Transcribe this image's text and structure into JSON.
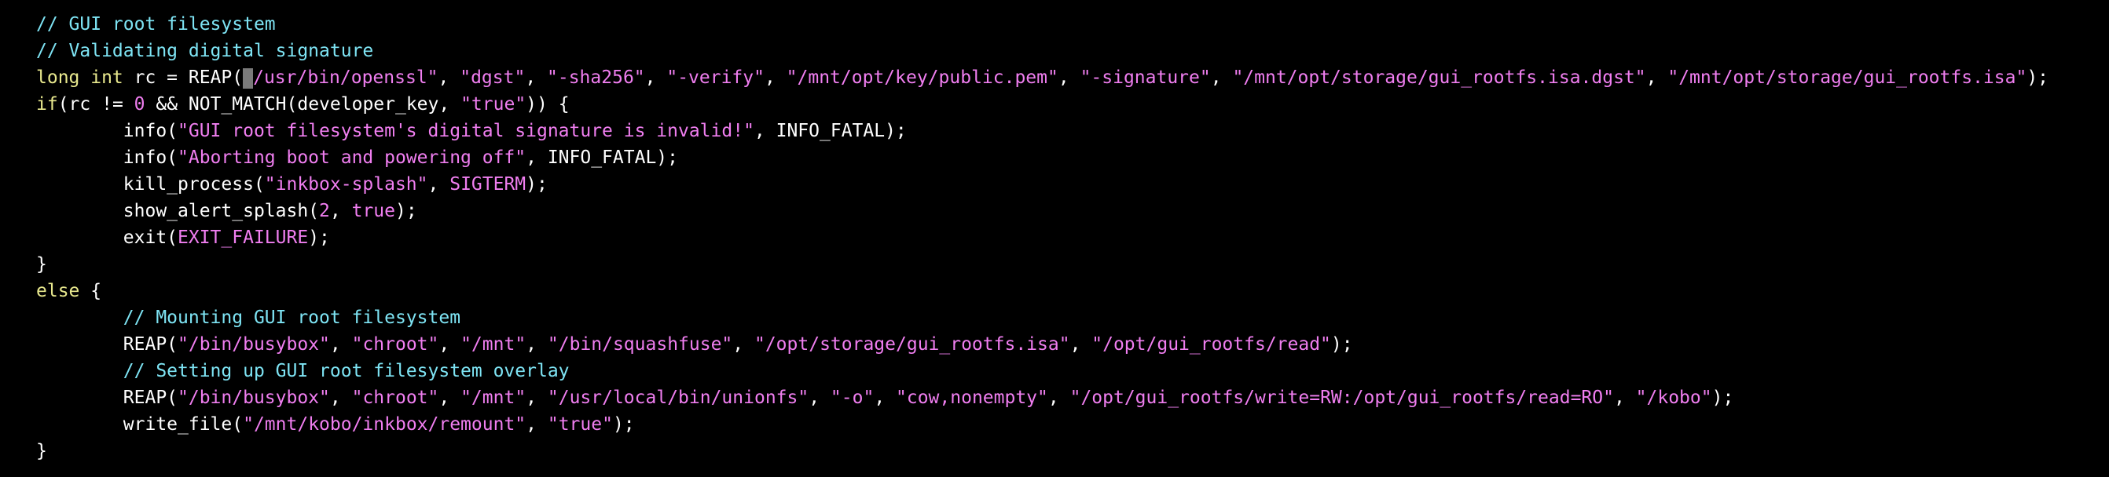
{
  "theme": {
    "background": "#000000",
    "text": "#ffffff",
    "comment": "#7ee4f4",
    "keyword": "#e9e98e",
    "string": "#f07ef0",
    "cursor": "#7a7a7a"
  },
  "code": {
    "lines": [
      [
        {
          "t": "// GUI root filesystem",
          "c": "comment"
        }
      ],
      [
        {
          "t": "// Validating digital signature",
          "c": "comment"
        }
      ],
      [
        {
          "t": "long int",
          "c": "type"
        },
        {
          "t": " rc = REAP(",
          "c": "plain"
        },
        {
          "t": "\"",
          "c": "cursor"
        },
        {
          "t": "/usr/bin/openssl\"",
          "c": "str"
        },
        {
          "t": ", ",
          "c": "plain"
        },
        {
          "t": "\"dgst\"",
          "c": "str"
        },
        {
          "t": ", ",
          "c": "plain"
        },
        {
          "t": "\"-sha256\"",
          "c": "str"
        },
        {
          "t": ", ",
          "c": "plain"
        },
        {
          "t": "\"-verify\"",
          "c": "str"
        },
        {
          "t": ", ",
          "c": "plain"
        },
        {
          "t": "\"/mnt/opt/key/public.pem\"",
          "c": "str"
        },
        {
          "t": ", ",
          "c": "plain"
        },
        {
          "t": "\"-signature\"",
          "c": "str"
        },
        {
          "t": ", ",
          "c": "plain"
        },
        {
          "t": "\"/mnt/opt/storage/gui_rootfs.isa.dgst\"",
          "c": "str"
        },
        {
          "t": ", ",
          "c": "plain"
        },
        {
          "t": "\"/mnt/opt/storage/gui_rootfs.isa\"",
          "c": "str"
        },
        {
          "t": ");",
          "c": "plain"
        }
      ],
      [
        {
          "t": "if",
          "c": "keyword"
        },
        {
          "t": "(rc != ",
          "c": "plain"
        },
        {
          "t": "0",
          "c": "const"
        },
        {
          "t": " && NOT_MATCH(developer_key, ",
          "c": "plain"
        },
        {
          "t": "\"true\"",
          "c": "str"
        },
        {
          "t": ")) {",
          "c": "plain"
        }
      ],
      [
        {
          "t": "        info(",
          "c": "plain"
        },
        {
          "t": "\"GUI root filesystem's digital signature is invalid!\"",
          "c": "str"
        },
        {
          "t": ", INFO_FATAL);",
          "c": "plain"
        }
      ],
      [
        {
          "t": "        info(",
          "c": "plain"
        },
        {
          "t": "\"Aborting boot and powering off\"",
          "c": "str"
        },
        {
          "t": ", INFO_FATAL);",
          "c": "plain"
        }
      ],
      [
        {
          "t": "        kill_process(",
          "c": "plain"
        },
        {
          "t": "\"inkbox-splash\"",
          "c": "str"
        },
        {
          "t": ", ",
          "c": "plain"
        },
        {
          "t": "SIGTERM",
          "c": "const"
        },
        {
          "t": ");",
          "c": "plain"
        }
      ],
      [
        {
          "t": "        show_alert_splash(",
          "c": "plain"
        },
        {
          "t": "2",
          "c": "const"
        },
        {
          "t": ", ",
          "c": "plain"
        },
        {
          "t": "true",
          "c": "const"
        },
        {
          "t": ");",
          "c": "plain"
        }
      ],
      [
        {
          "t": "        exit(",
          "c": "plain"
        },
        {
          "t": "EXIT_FAILURE",
          "c": "const"
        },
        {
          "t": ");",
          "c": "plain"
        }
      ],
      [
        {
          "t": "}",
          "c": "plain"
        }
      ],
      [
        {
          "t": "else",
          "c": "keyword"
        },
        {
          "t": " {",
          "c": "plain"
        }
      ],
      [
        {
          "t": "        ",
          "c": "plain"
        },
        {
          "t": "// Mounting GUI root filesystem",
          "c": "comment"
        }
      ],
      [
        {
          "t": "        REAP(",
          "c": "plain"
        },
        {
          "t": "\"/bin/busybox\"",
          "c": "str"
        },
        {
          "t": ", ",
          "c": "plain"
        },
        {
          "t": "\"chroot\"",
          "c": "str"
        },
        {
          "t": ", ",
          "c": "plain"
        },
        {
          "t": "\"/mnt\"",
          "c": "str"
        },
        {
          "t": ", ",
          "c": "plain"
        },
        {
          "t": "\"/bin/squashfuse\"",
          "c": "str"
        },
        {
          "t": ", ",
          "c": "plain"
        },
        {
          "t": "\"/opt/storage/gui_rootfs.isa\"",
          "c": "str"
        },
        {
          "t": ", ",
          "c": "plain"
        },
        {
          "t": "\"/opt/gui_rootfs/read\"",
          "c": "str"
        },
        {
          "t": ");",
          "c": "plain"
        }
      ],
      [
        {
          "t": "        ",
          "c": "plain"
        },
        {
          "t": "// Setting up GUI root filesystem overlay",
          "c": "comment"
        }
      ],
      [
        {
          "t": "        REAP(",
          "c": "plain"
        },
        {
          "t": "\"/bin/busybox\"",
          "c": "str"
        },
        {
          "t": ", ",
          "c": "plain"
        },
        {
          "t": "\"chroot\"",
          "c": "str"
        },
        {
          "t": ", ",
          "c": "plain"
        },
        {
          "t": "\"/mnt\"",
          "c": "str"
        },
        {
          "t": ", ",
          "c": "plain"
        },
        {
          "t": "\"/usr/local/bin/unionfs\"",
          "c": "str"
        },
        {
          "t": ", ",
          "c": "plain"
        },
        {
          "t": "\"-o\"",
          "c": "str"
        },
        {
          "t": ", ",
          "c": "plain"
        },
        {
          "t": "\"cow,nonempty\"",
          "c": "str"
        },
        {
          "t": ", ",
          "c": "plain"
        },
        {
          "t": "\"/opt/gui_rootfs/write=RW:/opt/gui_rootfs/read=RO\"",
          "c": "str"
        },
        {
          "t": ", ",
          "c": "plain"
        },
        {
          "t": "\"/kobo\"",
          "c": "str"
        },
        {
          "t": ");",
          "c": "plain"
        }
      ],
      [
        {
          "t": "        write_file(",
          "c": "plain"
        },
        {
          "t": "\"/mnt/kobo/inkbox/remount\"",
          "c": "str"
        },
        {
          "t": ", ",
          "c": "plain"
        },
        {
          "t": "\"true\"",
          "c": "str"
        },
        {
          "t": ");",
          "c": "plain"
        }
      ],
      [
        {
          "t": "}",
          "c": "plain"
        }
      ]
    ]
  }
}
